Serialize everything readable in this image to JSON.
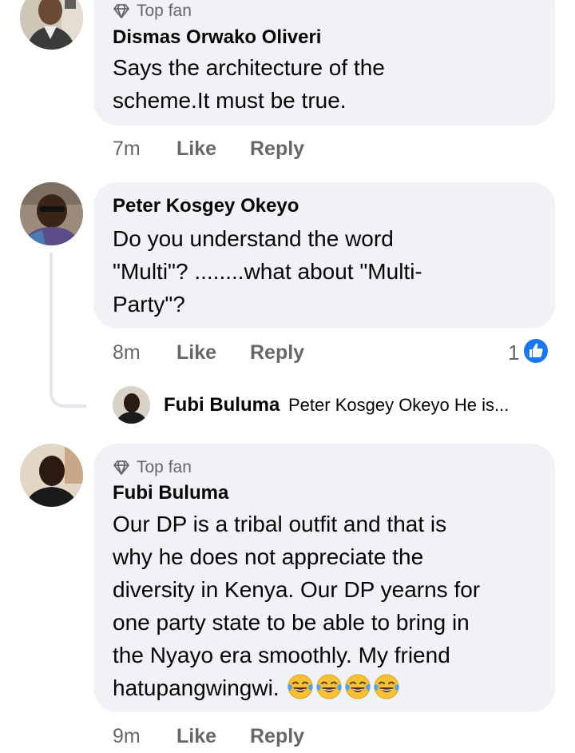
{
  "comments": [
    {
      "top_fan_label": "Top fan",
      "author": "Dismas Orwako Oliveri",
      "lines": [
        "Says the architecture of the",
        "scheme.It must be true."
      ],
      "time": "7m",
      "like_label": "Like",
      "reply_label": "Reply"
    },
    {
      "author": "Peter Kosgey Okeyo",
      "lines": [
        "Do you understand the word",
        "\"Multi\"? ........what about \"Multi-",
        "Party\"?"
      ],
      "time": "8m",
      "like_label": "Like",
      "reply_label": "Reply",
      "reaction_count": "1",
      "reaction_icon": "like-reaction-icon",
      "reply_preview": {
        "author": "Fubi Buluma",
        "snippet": "Peter Kosgey Okeyo He is..."
      }
    },
    {
      "top_fan_label": "Top fan",
      "author": "Fubi Buluma",
      "lines": [
        "Our DP is a tribal outfit and that is",
        "why he does not appreciate the",
        "diversity in Kenya.  Our DP yearns for",
        "one party state to be able to bring in",
        "the Nyayo era smoothly.  My friend",
        "hatupangwingwi. "
      ],
      "emoji_icon": "tears-of-joy-emoji",
      "emoji_count": 4,
      "time": "9m",
      "like_label": "Like",
      "reply_label": "Reply"
    }
  ],
  "colors": {
    "bubble": "#f0f2f5",
    "secondary_text": "#65676b",
    "like_blue": "#1877f2",
    "thread_line": "#e4e6eb"
  }
}
